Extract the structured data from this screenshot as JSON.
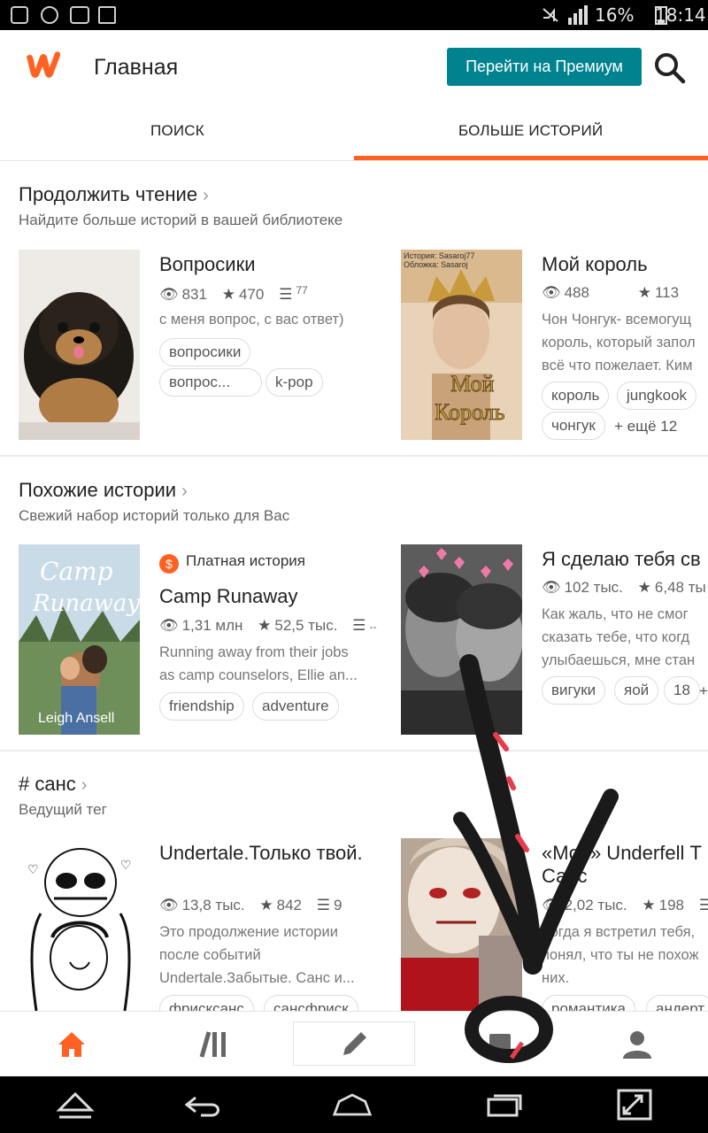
{
  "status_bar": {
    "battery": "16%",
    "time": "18:14"
  },
  "app_bar": {
    "title": "Главная",
    "premium_button": "Перейти на Премиум",
    "logo_icon": "wattpad-logo",
    "search_icon": "search-icon"
  },
  "tabs": [
    {
      "label": "ПОИСК",
      "active": false
    },
    {
      "label": "БОЛЬШЕ ИСТОРИЙ",
      "active": true
    }
  ],
  "accent_color": "#ff6122",
  "premium_color": "#00838f",
  "sections": {
    "continue": {
      "title": "Продолжить чтение",
      "subtitle": "Найдите больше историй в вашей библиотеке",
      "stories": [
        {
          "title": "Вопросики",
          "reads": "831",
          "votes": "470",
          "parts": "77",
          "description": [
            "с меня вопрос, с вас ответ)"
          ],
          "tags": [
            "вопросики",
            "вопрос...",
            "k-pop"
          ]
        },
        {
          "title": "Мой король",
          "reads": "488",
          "votes": "113",
          "description": [
            "Чон Чонгук- всемогущ",
            "король, который запол",
            "всё что пожелает. Ким"
          ],
          "tags": [
            "король",
            "jungkook",
            "чонгук"
          ],
          "more_tags": "+ ещё 12",
          "cover_text": "Мой Король",
          "cover_credit": [
            "История: Sasaroj77",
            "Обложка: Sasaroj"
          ]
        }
      ]
    },
    "similar": {
      "title": "Похожие истории",
      "subtitle": "Свежий набор историй только для Вас",
      "stories": [
        {
          "paid_label": "Платная история",
          "title": "Camp Runaway",
          "reads": "1,31 млн",
          "votes": "52,5 тыс.",
          "parts": "--",
          "description": [
            "Running away from their jobs",
            "as camp counselors, Ellie an..."
          ],
          "tags": [
            "friendship",
            "adventure"
          ],
          "cover_title": "Camp Runaway",
          "cover_author": "Leigh Ansell"
        },
        {
          "title": "Я сделаю тебя св",
          "reads": "102 тыс.",
          "votes": "6,48 ты",
          "description": [
            "Как жаль, что не смог",
            "сказать тебе, что когд",
            "улыбаешься, мне стан"
          ],
          "tags": [
            "вигуки",
            "яой",
            "18",
            "+"
          ]
        }
      ]
    },
    "tag": {
      "title": "# санс",
      "subtitle": "Ведущий тег",
      "stories": [
        {
          "title": "Undertale.Только твой.",
          "reads": "13,8 тыс.",
          "votes": "842",
          "parts": "9",
          "description": [
            "Это продолжение истории",
            "после событий",
            "Undertale.Забытые. Санс и..."
          ],
          "tags": [
            "фрисксанс",
            "сансфриск"
          ]
        },
        {
          "title": "«Моя» Underfell Т",
          "title_line2": "Санс",
          "reads": "2,02 тыс.",
          "votes": "198",
          "description": [
            "Когда я встретил тебя,",
            "понял, что ты не похож",
            "них."
          ],
          "tags": [
            "романтика",
            "андерт"
          ]
        }
      ]
    }
  },
  "bottom_nav": [
    "home-icon",
    "library-icon",
    "write-icon",
    "notifications-icon",
    "profile-icon"
  ]
}
